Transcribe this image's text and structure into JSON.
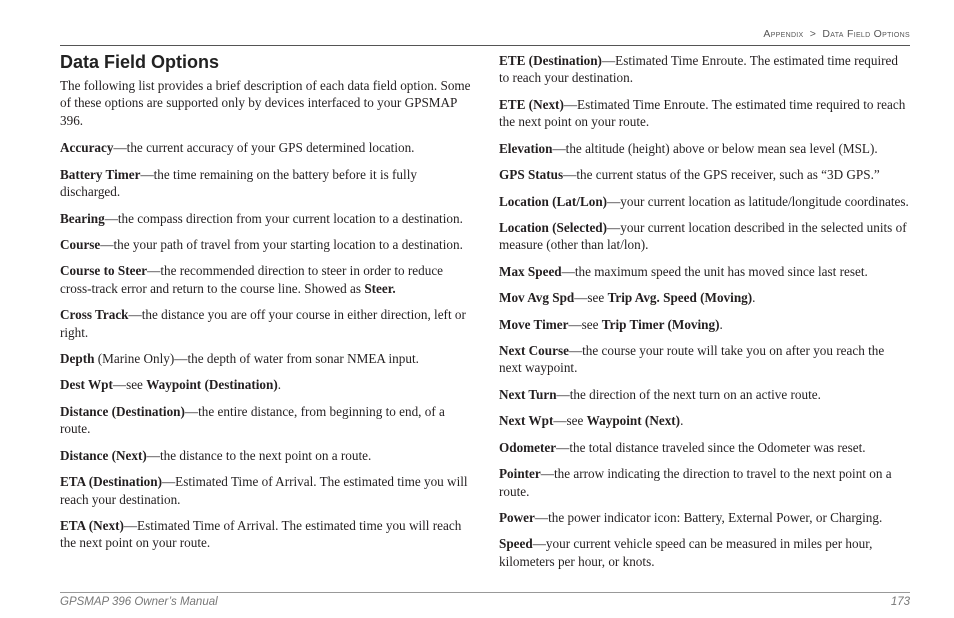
{
  "breadcrumb": {
    "section": "Appendix",
    "sep": ">",
    "page": "Data Field Options"
  },
  "title": "Data Field Options",
  "intro": "The following list provides a brief description of each data field option. Some of these options are supported only by devices interfaced to your GPSMAP 396.",
  "left": [
    {
      "term": "Accuracy",
      "desc": "—the current accuracy of your GPS determined location."
    },
    {
      "term": "Battery Timer",
      "desc": "—the time remaining on the battery before it is fully discharged."
    },
    {
      "term": "Bearing",
      "desc": "—the compass direction from your current location to a destination."
    },
    {
      "term": "Course",
      "desc": "—the your path of travel from your starting location to a destination."
    },
    {
      "term": "Course to Steer",
      "desc_pre": "—the recommended direction to steer in order to reduce cross-track error and return to the course line. Showed as ",
      "ref": "Steer."
    },
    {
      "term": "Cross Track",
      "desc": "—the distance you are off your course in either direction, left or right."
    },
    {
      "term": "Depth",
      "desc": " (Marine Only)—the depth of water from sonar NMEA input."
    },
    {
      "term": "Dest Wpt",
      "desc_pre": "—see ",
      "ref": "Waypoint (Destination)",
      "desc_post": "."
    },
    {
      "term": "Distance (Destination)",
      "desc": "—the entire distance, from beginning to end, of a route."
    },
    {
      "term": "Distance (Next)",
      "desc": "—the distance to the next point on a route."
    },
    {
      "term": "ETA (Destination)",
      "desc": "—Estimated Time of Arrival. The estimated time you will reach your destination."
    },
    {
      "term": "ETA (Next)",
      "desc": "—Estimated Time of Arrival. The estimated time you will reach the next point on your route."
    }
  ],
  "right": [
    {
      "term": "ETE (Destination)",
      "desc": "—Estimated Time Enroute. The estimated time required to reach your destination."
    },
    {
      "term": "ETE (Next)",
      "desc": "—Estimated Time Enroute. The estimated time required to reach the next point on your route."
    },
    {
      "term": "Elevation",
      "desc": "—the altitude (height) above or below mean sea level (MSL)."
    },
    {
      "term": "GPS Status",
      "desc": "—the current status of the GPS receiver, such as “3D GPS.”"
    },
    {
      "term": "Location (Lat/Lon)",
      "desc": "—your current location as latitude/longitude coordinates."
    },
    {
      "term": "Location (Selected)",
      "desc": "—your current location described in the selected units of measure (other than lat/lon)."
    },
    {
      "term": "Max Speed",
      "desc": "—the maximum speed the unit has moved since last reset."
    },
    {
      "term": "Mov Avg Spd",
      "desc_pre": "—see ",
      "ref": "Trip Avg. Speed (Moving)",
      "desc_post": "."
    },
    {
      "term": "Move Timer",
      "desc_pre": "—see ",
      "ref": "Trip Timer (Moving)",
      "desc_post": "."
    },
    {
      "term": "Next Course",
      "desc": "—the course your route will take you on after you reach the next waypoint."
    },
    {
      "term": "Next Turn",
      "desc": "—the direction of the next turn on an active route."
    },
    {
      "term": "Next Wpt",
      "desc_pre": "—see ",
      "ref": "Waypoint (Next)",
      "desc_post": "."
    },
    {
      "term": "Odometer",
      "desc": "—the total distance traveled since the Odometer was reset."
    },
    {
      "term": "Pointer",
      "desc": "—the arrow indicating the direction to travel to the next point on a route."
    },
    {
      "term": "Power",
      "desc": "—the power indicator icon: Battery, External Power, or Charging."
    },
    {
      "term": "Speed",
      "desc": "—your current vehicle speed can be measured in miles per hour, kilometers per hour, or knots."
    }
  ],
  "footer": {
    "label": "GPSMAP 396 Owner’s Manual",
    "page_num": "173"
  }
}
